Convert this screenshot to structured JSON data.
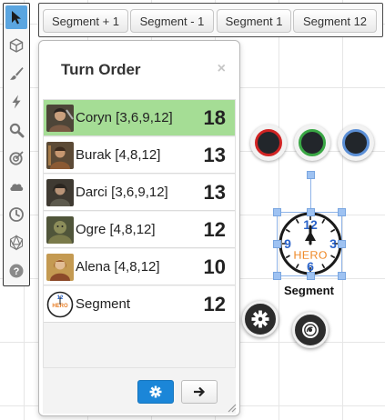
{
  "toolbar": {
    "tools": [
      {
        "icon": "cursor-icon",
        "active": true
      },
      {
        "icon": "cube-icon",
        "active": false
      },
      {
        "icon": "paintbrush-icon",
        "active": false
      },
      {
        "icon": "lightning-icon",
        "active": false
      },
      {
        "icon": "magnifier-icon",
        "active": false
      },
      {
        "icon": "target-icon",
        "active": false
      },
      {
        "icon": "cloud-icon",
        "active": false
      },
      {
        "icon": "clock-icon",
        "active": false
      },
      {
        "icon": "d20-dice-icon",
        "active": false
      },
      {
        "icon": "help-icon",
        "active": false
      }
    ],
    "accent_color": "#5aa5e0"
  },
  "segment_bar": {
    "buttons": [
      "Segment + 1",
      "Segment - 1",
      "Segment 1",
      "Segment 12"
    ]
  },
  "turn_order": {
    "title": "Turn Order",
    "close_glyph": "×",
    "active_color": "#a5dd95",
    "entries": [
      {
        "name": "Coryn [3,6,9,12]",
        "initiative": "18",
        "active": true,
        "avatar": "portrait-coryn"
      },
      {
        "name": "Burak [4,8,12]",
        "initiative": "13",
        "active": false,
        "avatar": "portrait-burak"
      },
      {
        "name": "Darci [3,6,9,12]",
        "initiative": "13",
        "active": false,
        "avatar": "portrait-darci"
      },
      {
        "name": "Ogre [4,8,12]",
        "initiative": "12",
        "active": false,
        "avatar": "portrait-ogre"
      },
      {
        "name": "Alena [4,8,12]",
        "initiative": "10",
        "active": false,
        "avatar": "portrait-alena"
      },
      {
        "name": "Segment",
        "initiative": "12",
        "active": false,
        "avatar": "hero-clock-icon"
      }
    ],
    "footer": {
      "settings_icon": "gear-icon",
      "next_icon": "arrow-right-icon"
    }
  },
  "token": {
    "label": "Segment",
    "clock_logo_text": "HERO",
    "clock_numbers": [
      "12",
      "3",
      "6",
      "9"
    ],
    "status_colors": [
      "#d12424",
      "#3aa745",
      "#5b8fd6"
    ],
    "menu_buttons": [
      "gear-icon",
      "token-settings-icon"
    ]
  }
}
